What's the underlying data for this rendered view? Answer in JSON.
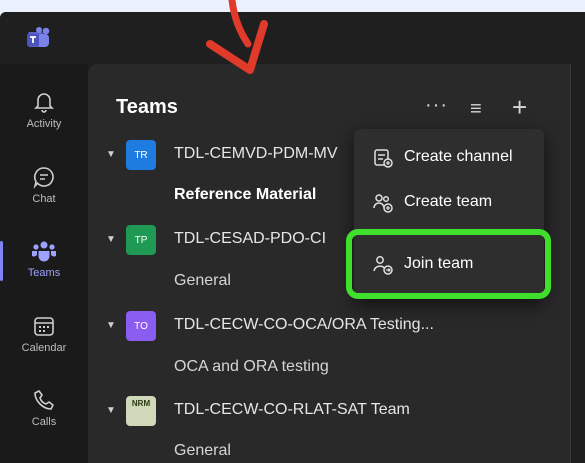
{
  "rail": {
    "items": [
      {
        "label": "Activity",
        "icon": "bell-icon"
      },
      {
        "label": "Chat",
        "icon": "chat-icon"
      },
      {
        "label": "Teams",
        "icon": "teams-icon",
        "active": true
      },
      {
        "label": "Calendar",
        "icon": "calendar-icon"
      },
      {
        "label": "Calls",
        "icon": "phone-icon"
      }
    ]
  },
  "panel": {
    "title": "Teams",
    "more_label": "···",
    "filter_label": "≡",
    "add_label": "+"
  },
  "teams": [
    {
      "initials": "TR",
      "name": "TDL-CEMVD-PDM-MV",
      "color": "#1e7be0",
      "channel": "Reference Material"
    },
    {
      "initials": "TP",
      "name": "TDL-CESAD-PDO-CI",
      "color": "#1f9a55",
      "channel": "General"
    },
    {
      "initials": "TO",
      "name": "TDL-CECW-CO-OCA/ORA Testing...",
      "color": "#8a5cf0",
      "channel": "OCA and ORA testing"
    },
    {
      "initials": "NRM",
      "name": "TDL-CECW-CO-RLAT-SAT Team",
      "color": "#6b7a3a",
      "channel": "General"
    }
  ],
  "menu": {
    "items": [
      {
        "label": "Create channel",
        "icon": "create-channel-icon"
      },
      {
        "label": "Create team",
        "icon": "create-team-icon"
      },
      {
        "label": "Join team",
        "icon": "join-team-icon"
      }
    ]
  },
  "colors": {
    "accent": "#7f85f5",
    "highlight": "#3ee02b",
    "arrow": "#e03a2a"
  }
}
